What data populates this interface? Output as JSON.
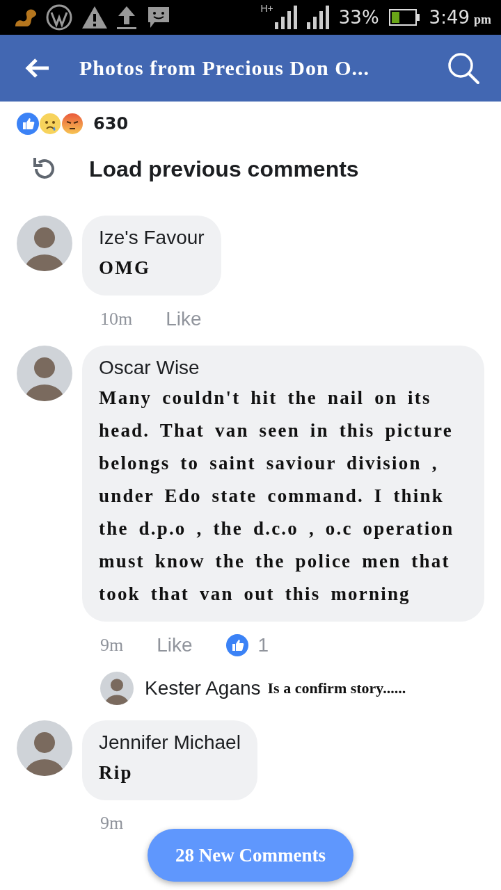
{
  "status_bar": {
    "network": "H+",
    "battery": "33%",
    "time": "3:49",
    "ampm": "pm"
  },
  "header": {
    "title": "Photos from Precious Don O..."
  },
  "reactions": {
    "count": "630"
  },
  "load_previous": "Load previous comments",
  "comments": [
    {
      "name": "Ize's Favour",
      "text": "OMG",
      "time": "10m",
      "like": "Like"
    },
    {
      "name": "Oscar Wise",
      "text": "Many couldn't hit the nail on its head. That van seen in this picture belongs to saint saviour division , under Edo state command. I think the d.p.o , the d.c.o , o.c operation must know the the police men that took that van out this morning",
      "time": "9m",
      "like": "Like",
      "like_count": "1",
      "reply": {
        "name": "Kester Agans",
        "text": "Is a confirm story......"
      }
    },
    {
      "name": "Jennifer Michael",
      "text": "Rip",
      "time": "9m"
    }
  ],
  "new_comments_button": "28 New Comments"
}
